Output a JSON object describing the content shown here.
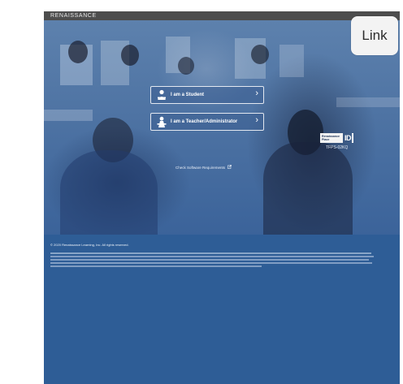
{
  "header": {
    "brand": "RENAISSANCE"
  },
  "login": {
    "student_label": "I am a Student",
    "teacher_label": "I am a Teacher/Administrator"
  },
  "product_logo": {
    "line1": "Renaissance",
    "line2": "Place",
    "suffix": "ID"
  },
  "site_code": "TFPS-02KQ",
  "software_link": "Check Software Requirements",
  "footer": {
    "copyright": "© 2020 Renaissance Learning, Inc. All rights reserved."
  },
  "badge": {
    "label": "Link"
  },
  "colors": {
    "page_blue": "#2e5d96",
    "topbar": "#4d4d4d",
    "badge_bg": "#f3f3f3"
  },
  "icons": {
    "student": "student-icon",
    "teacher": "teacher-icon",
    "chevron": "chevron-right-icon",
    "external": "external-link-icon"
  }
}
